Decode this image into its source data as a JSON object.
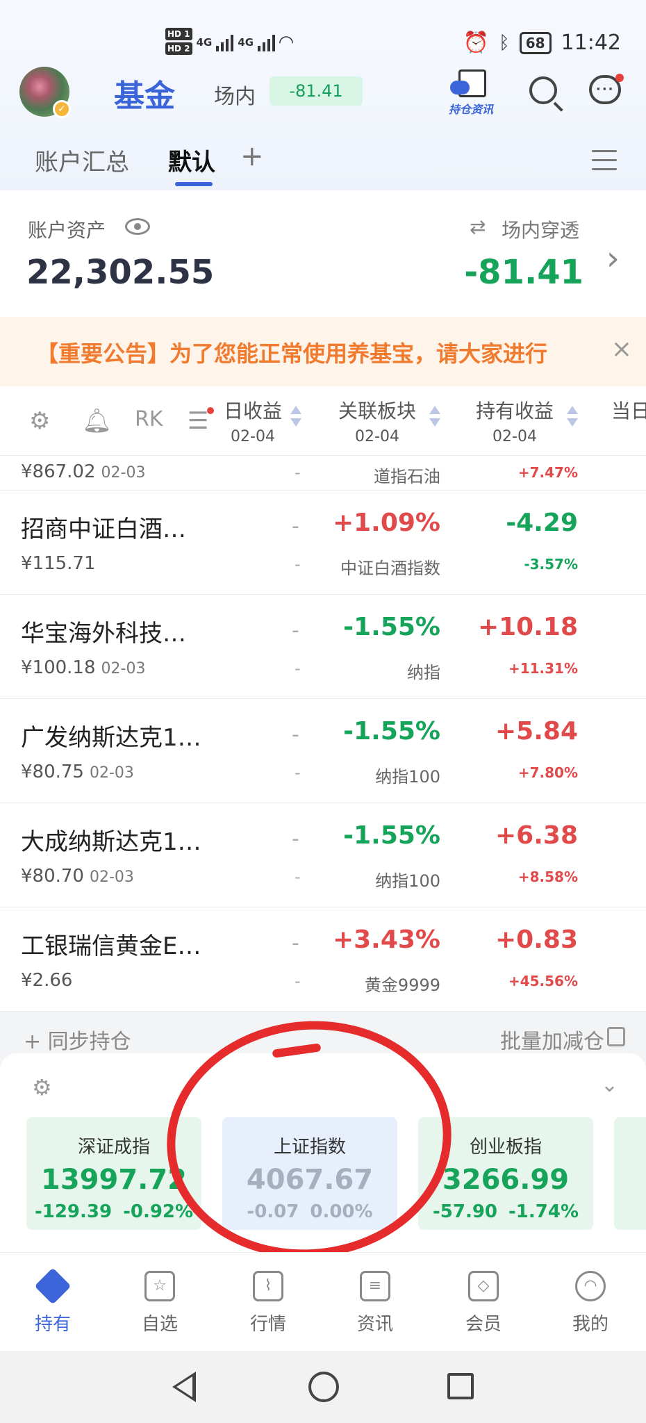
{
  "status_bar": {
    "hd1": "HD 1",
    "hd2": "HD 2",
    "net1": "4G",
    "net2": "4G",
    "battery": "68",
    "time": "11:42"
  },
  "header": {
    "title": "基金",
    "chang_label": "场内",
    "chang_value": "-81.41",
    "hold_news": "持仓资讯"
  },
  "tabs": {
    "items": [
      {
        "label": "账户汇总"
      },
      {
        "label": "默认"
      }
    ],
    "add": "+"
  },
  "asset": {
    "label": "账户资产",
    "value": "22,302.55",
    "penetrate_label": "场内穿透",
    "penetrate_value": "-81.41"
  },
  "notice": {
    "text": "【重要公告】为了您能正常使用养基宝，请大家进行",
    "close": "×"
  },
  "columns": {
    "daily": {
      "title": "日收益",
      "date": "02-04"
    },
    "sector": {
      "title": "关联板块",
      "date": "02-04"
    },
    "hold": {
      "title": "持有收益",
      "date": "02-04"
    },
    "today": {
      "title": "当日"
    }
  },
  "partial_row": {
    "nav": "¥867.02",
    "date": "02-03",
    "dash": "-",
    "sector": "道指石油",
    "hold_pct": "+7.47%"
  },
  "funds": [
    {
      "name": "招商中证白酒…",
      "nav": "¥115.71",
      "date": "",
      "dash1": "-",
      "dash2": "-",
      "rel": "+1.09%",
      "rel_dir": "up",
      "sector": "中证白酒指数",
      "hold": "-4.29",
      "hold_dir": "dn",
      "hold_pct": "-3.57%"
    },
    {
      "name": "华宝海外科技…",
      "nav": "¥100.18",
      "date": "02-03",
      "dash1": "-",
      "dash2": "-",
      "rel": "-1.55%",
      "rel_dir": "dn",
      "sector": "纳指",
      "hold": "+10.18",
      "hold_dir": "up",
      "hold_pct": "+11.31%"
    },
    {
      "name": "广发纳斯达克1…",
      "nav": "¥80.75",
      "date": "02-03",
      "dash1": "-",
      "dash2": "-",
      "rel": "-1.55%",
      "rel_dir": "dn",
      "sector": "纳指100",
      "hold": "+5.84",
      "hold_dir": "up",
      "hold_pct": "+7.80%"
    },
    {
      "name": "大成纳斯达克1…",
      "nav": "¥80.70",
      "date": "02-03",
      "dash1": "-",
      "dash2": "-",
      "rel": "-1.55%",
      "rel_dir": "dn",
      "sector": "纳指100",
      "hold": "+6.38",
      "hold_dir": "up",
      "hold_pct": "+8.58%"
    },
    {
      "name": "工银瑞信黄金E…",
      "nav": "¥2.66",
      "date": "",
      "dash1": "-",
      "dash2": "-",
      "rel": "+3.43%",
      "rel_dir": "up",
      "sector": "黄金9999",
      "hold": "+0.83",
      "hold_dir": "up",
      "hold_pct": "+45.56%"
    }
  ],
  "sync": {
    "left": "+ 同步持仓",
    "right": "批量加减仓"
  },
  "indices": [
    {
      "name": "深证成指",
      "value": "13997.72",
      "change": "-129.39",
      "pct": "-0.92%"
    },
    {
      "name": "上证指数",
      "value": "4067.67",
      "change": "-0.07",
      "pct": "0.00%"
    },
    {
      "name": "创业板指",
      "value": "3266.99",
      "change": "-57.90",
      "pct": "-1.74%"
    }
  ],
  "bottom_nav": [
    {
      "label": "持有",
      "icon": "layers-icon"
    },
    {
      "label": "自选",
      "icon": "star-icon"
    },
    {
      "label": "行情",
      "icon": "chart-icon"
    },
    {
      "label": "资讯",
      "icon": "news-icon"
    },
    {
      "label": "会员",
      "icon": "vip-icon"
    },
    {
      "label": "我的",
      "icon": "user-icon"
    }
  ],
  "colors": {
    "accent": "#3a64d8",
    "up": "#e04a4a",
    "down": "#16a35a",
    "notice": "#f07a2e",
    "annotation": "#e52b2b"
  }
}
